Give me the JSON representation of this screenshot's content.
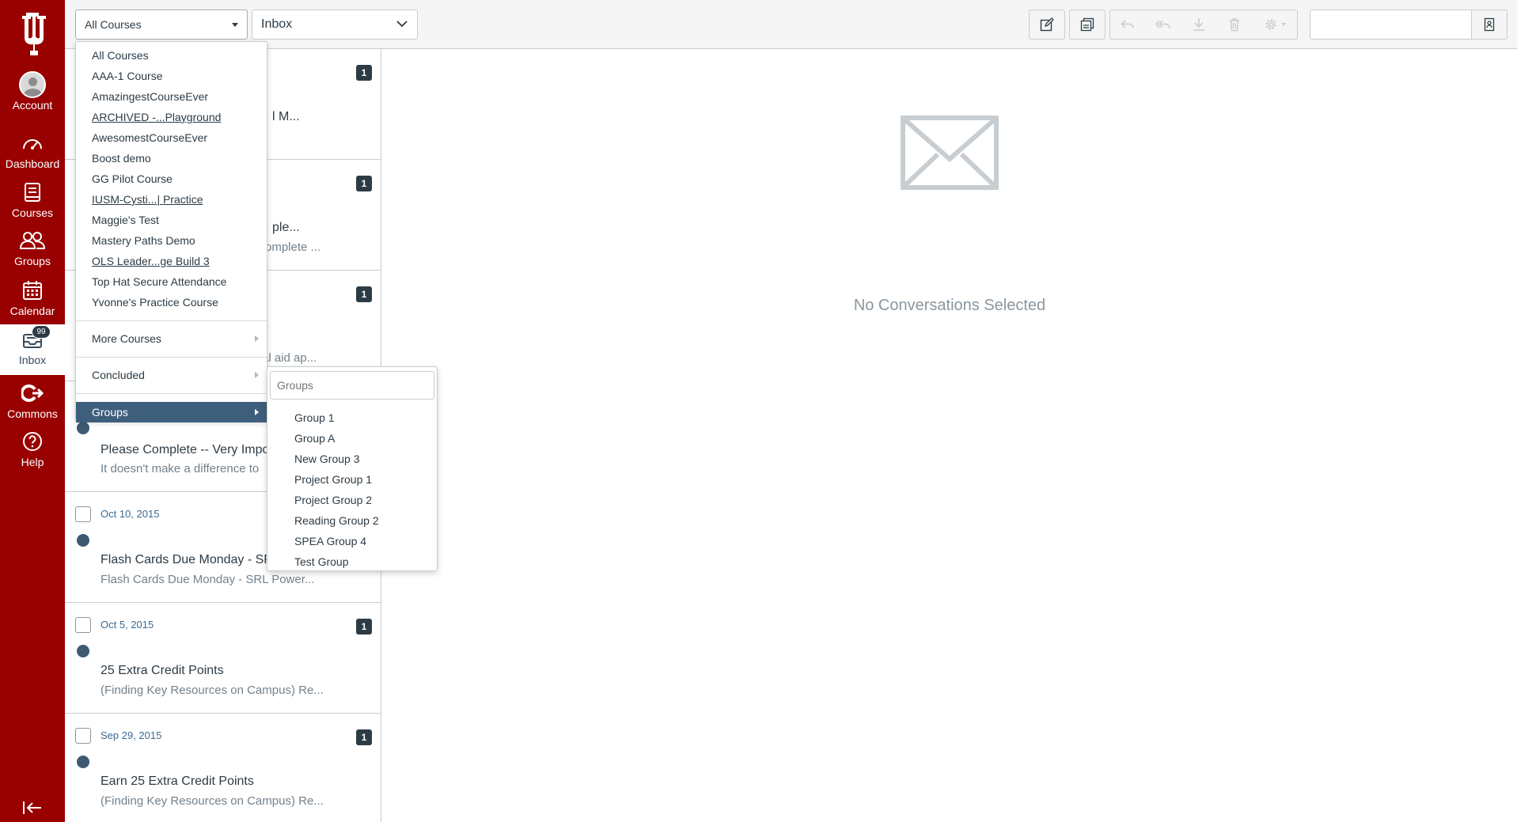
{
  "nav": {
    "account": "Account",
    "dashboard": "Dashboard",
    "courses": "Courses",
    "groups": "Groups",
    "calendar": "Calendar",
    "inbox": "Inbox",
    "inbox_badge": "99",
    "commons": "Commons",
    "help": "Help"
  },
  "toolbar": {
    "course_filter": "All Courses",
    "mailbox_filter": "Inbox",
    "search_value": ""
  },
  "course_menu": {
    "items": [
      "All Courses",
      "AAA-1 Course",
      "AmazingestCourseEver",
      "ARCHIVED -...Playground",
      "AwesomestCourseEver",
      "Boost demo",
      "GG Pilot Course",
      "IUSM-Cysti...| Practice",
      "Maggie's Test",
      "Mastery Paths Demo",
      "OLS Leader...ge Build 3",
      "Top Hat Secure Attendance",
      "Yvonne's Practice Course"
    ],
    "more_courses": "More Courses",
    "concluded": "Concluded",
    "groups": "Groups"
  },
  "groups_menu": {
    "filter_placeholder": "Groups",
    "items": [
      "Group 1",
      "Group A",
      "New Group 3",
      "Project Group 1",
      "Project Group 2",
      "Reading Group 2",
      "SPEA Group 4",
      "Test Group"
    ]
  },
  "conversations": {
    "c1": {
      "count": "1",
      "subject_fragment": "l M..."
    },
    "c2": {
      "count": "1",
      "subject_fragment": "ple...",
      "preview_fragment": "omplete ..."
    },
    "c3": {
      "count": "1",
      "preview_fragment": "al aid ap..."
    },
    "c4": {
      "subject": "Please Complete -- Very Impor",
      "preview": "It doesn't make a difference to"
    },
    "c5": {
      "date": "Oct 10, 2015",
      "subject": "Flash Cards Due Monday - SR",
      "preview": "Flash Cards Due Monday - SRL Power..."
    },
    "c6": {
      "date": "Oct 5, 2015",
      "count": "1",
      "subject": "25 Extra Credit Points",
      "preview": "(Finding Key Resources on Campus) Re..."
    },
    "c7": {
      "date": "Sep 29, 2015",
      "count": "1",
      "subject": "Earn 25 Extra Credit Points",
      "preview": "(Finding Key Resources on Campus) Re..."
    }
  },
  "content": {
    "empty_state": "No Conversations Selected"
  },
  "colors": {
    "nav_background": "#990000",
    "highlight": "#3e5f7c",
    "date_link": "#3a6b93"
  }
}
